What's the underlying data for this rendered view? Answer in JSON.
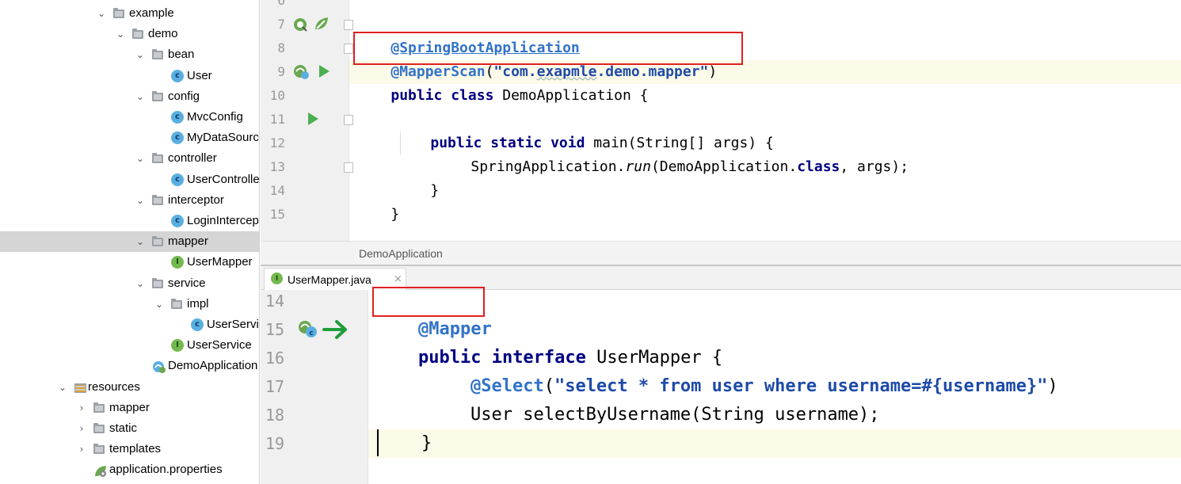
{
  "tree": {
    "items": [
      {
        "label": "example",
        "arrow": "⌄",
        "icon": "folder"
      },
      {
        "label": "demo",
        "arrow": "⌄",
        "icon": "folder"
      },
      {
        "label": "bean",
        "arrow": "⌄",
        "icon": "folder"
      },
      {
        "label": "User",
        "arrow": "",
        "icon": "class",
        "badge": "c"
      },
      {
        "label": "config",
        "arrow": "⌄",
        "icon": "folder"
      },
      {
        "label": "MvcConfig",
        "arrow": "",
        "icon": "class",
        "badge": "c"
      },
      {
        "label": "MyDataSource",
        "arrow": "",
        "icon": "class",
        "badge": "c"
      },
      {
        "label": "controller",
        "arrow": "⌄",
        "icon": "folder"
      },
      {
        "label": "UserController",
        "arrow": "",
        "icon": "class",
        "badge": "c"
      },
      {
        "label": "interceptor",
        "arrow": "⌄",
        "icon": "folder"
      },
      {
        "label": "LoginInterceptor",
        "arrow": "",
        "icon": "class",
        "badge": "c"
      },
      {
        "label": "mapper",
        "arrow": "⌄",
        "icon": "folder",
        "selected": true
      },
      {
        "label": "UserMapper",
        "arrow": "",
        "icon": "interface",
        "badge": "I"
      },
      {
        "label": "service",
        "arrow": "⌄",
        "icon": "folder"
      },
      {
        "label": "impl",
        "arrow": "⌄",
        "icon": "folder"
      },
      {
        "label": "UserServiceImpl",
        "arrow": "",
        "icon": "class",
        "badge": "c"
      },
      {
        "label": "UserService",
        "arrow": "",
        "icon": "interface",
        "badge": "I"
      },
      {
        "label": "DemoApplication",
        "arrow": "",
        "icon": "spring-boot"
      },
      {
        "label": "resources",
        "arrow": "⌄",
        "icon": "resources"
      },
      {
        "label": "mapper",
        "arrow": "›",
        "icon": "folder"
      },
      {
        "label": "static",
        "arrow": "›",
        "icon": "folder"
      },
      {
        "label": "templates",
        "arrow": "›",
        "icon": "folder"
      },
      {
        "label": "application.properties",
        "arrow": "",
        "icon": "properties"
      }
    ]
  },
  "top_editor": {
    "line_numbers": [
      "6",
      "7",
      "8",
      "9",
      "10",
      "11",
      "12",
      "13",
      "14",
      "15"
    ],
    "code": {
      "l7": "@SpringBootApplication",
      "l8_ann": "@MapperScan",
      "l8_open": "(",
      "l8_str_a": "\"com.",
      "l8_str_b": "exapmle",
      "l8_str_c": ".demo.mapper\"",
      "l8_close": ")",
      "l9_kw": "public class",
      "l9_rest": " DemoApplication {",
      "l11_kw": "public static void",
      "l11_rest": " main(String[] args) {",
      "l12_a": "SpringApplication.",
      "l12_b": "run",
      "l12_c": "(DemoApplication.",
      "l12_d": "class",
      "l12_e": ", args);",
      "l13": "}",
      "l14": "}"
    },
    "colors": {
      "annotation": "#3273c8",
      "keyword": "#000080",
      "highlight": "#e02020"
    }
  },
  "breadcrumb": {
    "label": "DemoApplication"
  },
  "tabs": [
    {
      "label": "UserMapper.java",
      "close": "×",
      "badge": "I"
    }
  ],
  "bottom_editor": {
    "line_numbers": [
      "14",
      "15",
      "16",
      "17",
      "18",
      "19"
    ],
    "code": {
      "l14": "@Mapper",
      "l15_kw": "public interface",
      "l15_rest": " UserMapper {",
      "l16_ann": "@Select",
      "l16_open": "(",
      "l16_str": "\"select * from user where username=#{username}\"",
      "l16_close": ")",
      "l17": "User selectByUsername(String username);",
      "l18": "}"
    }
  }
}
